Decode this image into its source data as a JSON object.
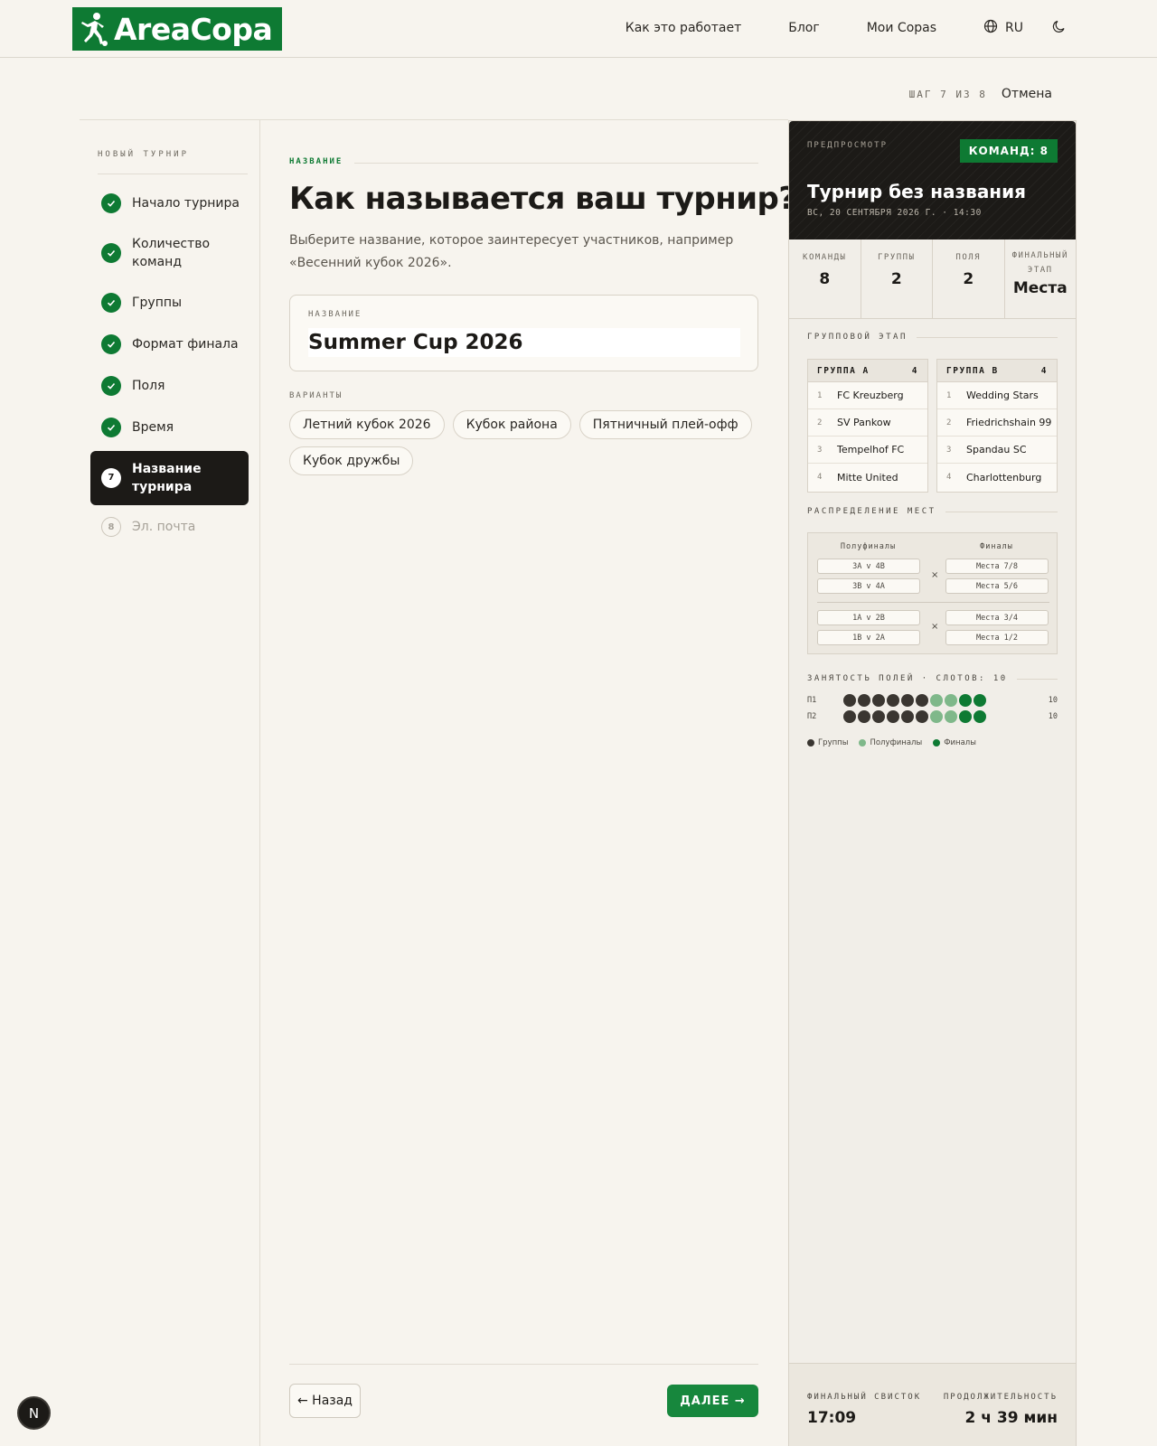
{
  "header": {
    "logo_text": "AreaCopa",
    "nav": [
      "Как это работает",
      "Блог",
      "Мои Copas"
    ],
    "lang": "RU",
    "brand_color": "#0e7a33"
  },
  "stepper": {
    "step_text": "ШАГ 7 ИЗ 8",
    "cancel": "Отмена"
  },
  "sidebar": {
    "title": "НОВЫЙ ТУРНИР",
    "items": [
      {
        "label": "Начало турнира",
        "state": "done"
      },
      {
        "label": "Количество команд",
        "state": "done"
      },
      {
        "label": "Группы",
        "state": "done"
      },
      {
        "label": "Формат финала",
        "state": "done"
      },
      {
        "label": "Поля",
        "state": "done"
      },
      {
        "label": "Время",
        "state": "done"
      },
      {
        "label": "Название турнира",
        "state": "active",
        "num": "7"
      },
      {
        "label": "Эл. почта",
        "state": "pending",
        "num": "8"
      }
    ]
  },
  "main": {
    "section_label": "НАЗВАНИЕ",
    "title": "Как называется ваш турнир?",
    "description": "Выберите название, которое заинтересует участников, например «Весенний кубок 2026».",
    "input_label": "НАЗВАНИЕ",
    "input_value": "Summer Cup 2026",
    "variants_label": "ВАРИАНТЫ",
    "variants": [
      "Летний кубок 2026",
      "Кубок района",
      "Пятничный плей-офф",
      "Кубок дружбы"
    ],
    "back": "← Назад",
    "next": "ДАЛЕЕ →"
  },
  "preview": {
    "label": "ПРЕДПРОСМОТР",
    "badge": "КОМАНД: 8",
    "title": "Турнир без названия",
    "subtitle": "ВС, 20 СЕНТЯБРЯ 2026 Г. · 14:30",
    "stats": [
      {
        "label": "КОМАНДЫ",
        "value": "8"
      },
      {
        "label": "ГРУППЫ",
        "value": "2"
      },
      {
        "label": "ПОЛЯ",
        "value": "2"
      },
      {
        "label": "ФИНАЛЬНЫЙ ЭТАП",
        "value": "Места"
      }
    ],
    "group_stage_label": "ГРУППОВОЙ ЭТАП",
    "groups": [
      {
        "name": "ГРУППА A",
        "count": "4",
        "teams": [
          [
            "1",
            "FC Kreuzberg"
          ],
          [
            "2",
            "SV Pankow"
          ],
          [
            "3",
            "Tempelhof FC"
          ],
          [
            "4",
            "Mitte United"
          ]
        ]
      },
      {
        "name": "ГРУППА B",
        "count": "4",
        "teams": [
          [
            "1",
            "Wedding Stars"
          ],
          [
            "2",
            "Friedrichshain 99"
          ],
          [
            "3",
            "Spandau SC"
          ],
          [
            "4",
            "Charlottenburg"
          ]
        ]
      }
    ],
    "placement_label": "РАСПРЕДЕЛЕНИЕ МЕСТ",
    "bracket": {
      "semis_label": "Полуфиналы",
      "finals_label": "Финалы",
      "semis": [
        "3A v 4B",
        "3B v 4A",
        "1A v 2B",
        "1B v 2A"
      ],
      "finals": [
        "Места 7/8",
        "Места 5/6",
        "Места 3/4",
        "Места 1/2"
      ],
      "vs": "×"
    },
    "fields_label": "ЗАНЯТОСТЬ ПОЛЕЙ · СЛОТОВ: 10",
    "fields": [
      {
        "name": "П1",
        "count": "10",
        "slots": [
          "g",
          "g",
          "g",
          "g",
          "g",
          "g",
          "s",
          "s",
          "f",
          "f"
        ]
      },
      {
        "name": "П2",
        "count": "10",
        "slots": [
          "g",
          "g",
          "g",
          "g",
          "g",
          "g",
          "s",
          "s",
          "f",
          "f"
        ]
      }
    ],
    "legend": [
      {
        "label": "Группы",
        "color": "#3a3631"
      },
      {
        "label": "Полуфиналы",
        "color": "#7fb88a"
      },
      {
        "label": "Финалы",
        "color": "#0e7a33"
      }
    ],
    "final_whistle_label": "ФИНАЛЬНЫЙ СВИСТОК",
    "final_whistle": "17:09",
    "duration_label": "ПРОДОЛЖИТЕЛЬНОСТЬ",
    "duration": "2 ч 39 мин"
  },
  "dev_badge": "N"
}
